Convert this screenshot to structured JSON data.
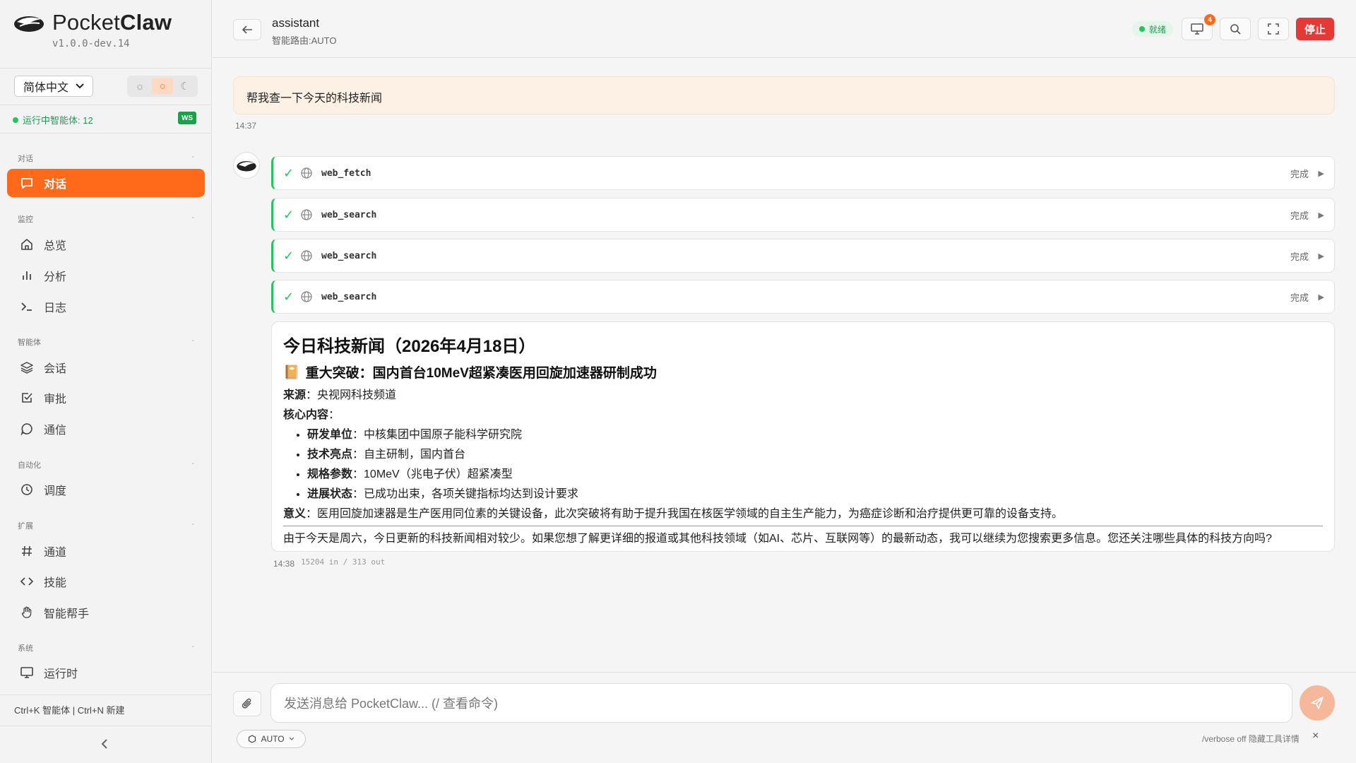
{
  "sidebar": {
    "brand_light": "Pocket",
    "brand_bold": "Claw",
    "version": "v1.0.0-dev.14",
    "language": "简体中文",
    "running_agents": "运行中智能体: 12",
    "ws_badge": "WS",
    "sections": [
      {
        "title": "对话",
        "items": [
          {
            "label": "对话",
            "icon": "chat-icon",
            "active": true
          }
        ]
      },
      {
        "title": "监控",
        "items": [
          {
            "label": "总览",
            "icon": "home-icon"
          },
          {
            "label": "分析",
            "icon": "bar-chart-icon"
          },
          {
            "label": "日志",
            "icon": "terminal-icon"
          }
        ]
      },
      {
        "title": "智能体",
        "items": [
          {
            "label": "会话",
            "icon": "layers-icon"
          },
          {
            "label": "审批",
            "icon": "checkbox-icon"
          },
          {
            "label": "通信",
            "icon": "message-icon"
          }
        ]
      },
      {
        "title": "自动化",
        "items": [
          {
            "label": "调度",
            "icon": "clock-icon"
          }
        ]
      },
      {
        "title": "扩展",
        "items": [
          {
            "label": "通道",
            "icon": "hash-icon"
          },
          {
            "label": "技能",
            "icon": "code-icon"
          },
          {
            "label": "智能帮手",
            "icon": "hand-icon"
          }
        ]
      },
      {
        "title": "系统",
        "items": [
          {
            "label": "运行时",
            "icon": "monitor-icon"
          }
        ]
      }
    ],
    "collapse_marker": "-",
    "shortcuts": "Ctrl+K 智能体 | Ctrl+N 新建"
  },
  "header": {
    "title": "assistant",
    "subtitle": "智能路由:AUTO",
    "status": "就绪",
    "notification_count": "4",
    "stop_label": "停止"
  },
  "chat": {
    "user_message": "帮我查一下今天的科技新闻",
    "user_time": "14:37",
    "tool_calls": [
      {
        "name": "web_fetch",
        "status": "完成"
      },
      {
        "name": "web_search",
        "status": "完成"
      },
      {
        "name": "web_search",
        "status": "完成"
      },
      {
        "name": "web_search",
        "status": "完成"
      }
    ],
    "reply": {
      "title": "今日科技新闻（2026年4月18日）",
      "headline_icon": "📔",
      "headline": "重大突破：国内首台10MeV超紧凑医用回旋加速器研制成功",
      "source_label": "来源",
      "source_value": "：央视网科技频道",
      "core_label": "核心内容",
      "core_suffix": "：",
      "bullets": [
        {
          "label": "研发单位",
          "value": "：中核集团中国原子能科学研究院"
        },
        {
          "label": "技术亮点",
          "value": "：自主研制，国内首台"
        },
        {
          "label": "规格参数",
          "value": "：10MeV（兆电子伏）超紧凑型"
        },
        {
          "label": "进展状态",
          "value": "：已成功出束，各项关键指标均达到设计要求"
        }
      ],
      "meaning_label": "意义",
      "meaning_value": "：医用回旋加速器是生产医用同位素的关键设备，此次突破将有助于提升我国在核医学领域的自主生产能力，为癌症诊断和治疗提供更可靠的设备支持。",
      "closing": "由于今天是周六，今日更新的科技新闻相对较少。如果您想了解更详细的报道或其他科技领域（如AI、芯片、互联网等）的最新动态，我可以继续为您搜索更多信息。您还关注哪些具体的科技方向吗?"
    },
    "reply_time": "14:38",
    "token_usage": "15204 in / 313 out"
  },
  "composer": {
    "placeholder": "发送消息给 PocketClaw... (/ 查看命令)",
    "mode": "AUTO",
    "verbose_hint": "/verbose off 隐藏工具详情",
    "close": "×"
  },
  "colors": {
    "accent": "#ff6a1a",
    "success": "#22c55e",
    "stop": "#e53935",
    "user_bubble": "#fdf1e5"
  }
}
